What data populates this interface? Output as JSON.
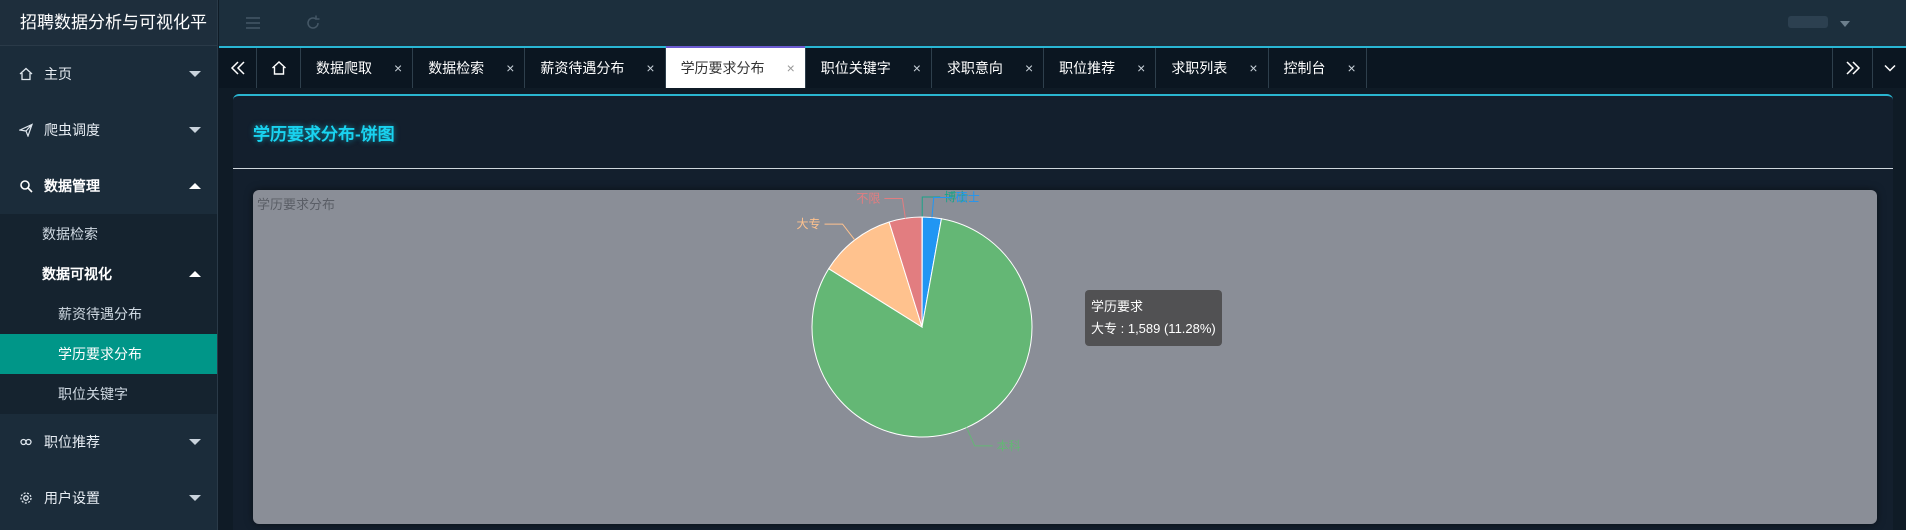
{
  "app": {
    "title": "招聘数据分析与可视化平"
  },
  "sidebar": {
    "items": [
      {
        "label": "主页",
        "expanded": false
      },
      {
        "label": "爬虫调度",
        "expanded": false
      },
      {
        "label": "数据管理",
        "expanded": true
      },
      {
        "label": "职位推荐",
        "expanded": false
      },
      {
        "label": "用户设置",
        "expanded": false
      }
    ],
    "data_mgmt_children": {
      "search": "数据检索",
      "viz_group": "数据可视化",
      "viz_items": [
        "薪资待遇分布",
        "学历要求分布",
        "职位关键字"
      ]
    }
  },
  "tabs": [
    {
      "label": "数据爬取",
      "active": false
    },
    {
      "label": "数据检索",
      "active": false
    },
    {
      "label": "薪资待遇分布",
      "active": false
    },
    {
      "label": "学历要求分布",
      "active": true
    },
    {
      "label": "职位关键字",
      "active": false
    },
    {
      "label": "求职意向",
      "active": false
    },
    {
      "label": "职位推荐",
      "active": false
    },
    {
      "label": "求职列表",
      "active": false
    },
    {
      "label": "控制台",
      "active": false
    }
  ],
  "tab_close_glyph": "×",
  "page": {
    "title": "学历要求分布-饼图"
  },
  "chart_data": {
    "type": "pie",
    "title": "学历要求分布",
    "series_name": "学历要求",
    "slices": [
      {
        "label": "博士",
        "value": 8,
        "color": "#1aa389"
      },
      {
        "label": "硕士",
        "value": 390,
        "color": "#2196f3"
      },
      {
        "label": "本科",
        "value": 11420,
        "color": "#64b775"
      },
      {
        "label": "大专",
        "value": 1589,
        "color": "#ffc28e"
      },
      {
        "label": "不限",
        "value": 680,
        "color": "#e27d80"
      }
    ],
    "tooltip": {
      "series": "学历要求",
      "text": "大专 : 1,589 (11.28%)"
    }
  },
  "colors": {
    "accent": "#19d3f0",
    "active_menu": "#009688",
    "sidebar_bg": "#1b2c3a"
  }
}
